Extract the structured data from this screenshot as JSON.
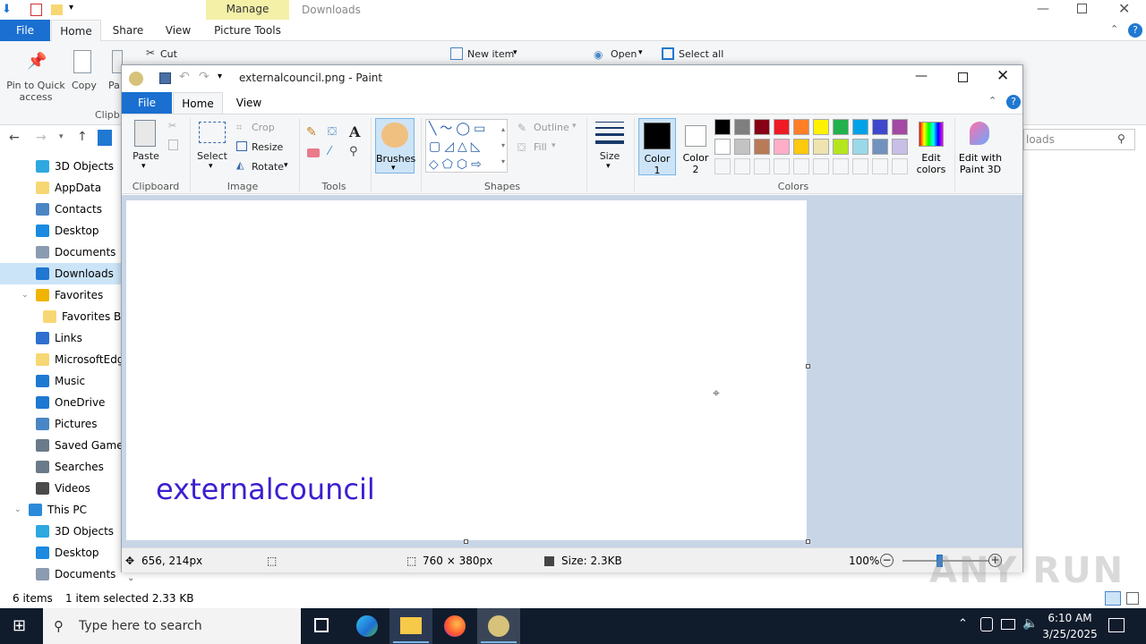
{
  "explorer": {
    "manage_tab": "Manage",
    "title": "Downloads",
    "tabs": {
      "file": "File",
      "home": "Home",
      "share": "Share",
      "view": "View",
      "picture_tools": "Picture Tools"
    },
    "ribbon": {
      "pin_line1": "Pin to Quick",
      "pin_line2": "access",
      "copy": "Copy",
      "paste_partial": "Pa",
      "cut": "Cut",
      "clipboard_partial": "Clipb",
      "new_item": "New item",
      "open": "Open",
      "select_all": "Select all"
    },
    "search_partial": "loads",
    "tree": [
      {
        "label": "3D Objects",
        "color": "#2ea8e0"
      },
      {
        "label": "AppData",
        "color": "#f7d774"
      },
      {
        "label": "Contacts",
        "color": "#4a86c5"
      },
      {
        "label": "Desktop",
        "color": "#1b8ae0"
      },
      {
        "label": "Documents",
        "color": "#8b9bb0"
      },
      {
        "label": "Downloads",
        "color": "#1f78d1"
      },
      {
        "label": "Favorites",
        "color": "#f0b400"
      },
      {
        "label": "Favorites Bar",
        "color": "#f7d774"
      },
      {
        "label": "Links",
        "color": "#2f6fd0"
      },
      {
        "label": "MicrosoftEdge",
        "color": "#f7d774"
      },
      {
        "label": "Music",
        "color": "#1f78d1"
      },
      {
        "label": "OneDrive",
        "color": "#1f78d1"
      },
      {
        "label": "Pictures",
        "color": "#4a86c5"
      },
      {
        "label": "Saved Games",
        "color": "#6a7a8a"
      },
      {
        "label": "Searches",
        "color": "#6a7a8a"
      },
      {
        "label": "Videos",
        "color": "#4a4a4a"
      },
      {
        "label": "This PC",
        "color": "#2a8ad8"
      },
      {
        "label": "3D Objects",
        "color": "#2ea8e0"
      },
      {
        "label": "Desktop",
        "color": "#1b8ae0"
      },
      {
        "label": "Documents",
        "color": "#8b9bb0"
      }
    ],
    "status": {
      "items": "6 items",
      "selected": "1 item selected  2.33 KB"
    }
  },
  "paint": {
    "title": "externalcouncil.png - Paint",
    "tabs": {
      "file": "File",
      "home": "Home",
      "view": "View"
    },
    "ribbon": {
      "paste": "Paste",
      "clipboard": "Clipboard",
      "select": "Select",
      "crop": "Crop",
      "resize": "Resize",
      "rotate": "Rotate",
      "image": "Image",
      "tools": "Tools",
      "brushes": "Brushes",
      "outline": "Outline",
      "fill": "Fill",
      "shapes": "Shapes",
      "size": "Size",
      "color1_line1": "Color",
      "color1_line2": "1",
      "color2_line1": "Color",
      "color2_line2": "2",
      "colors": "Colors",
      "edit_colors_line1": "Edit",
      "edit_colors_line2": "colors",
      "paint3d_line1": "Edit with",
      "paint3d_line2": "Paint 3D"
    },
    "palette_row1": [
      "#000000",
      "#7f7f7f",
      "#880015",
      "#ed1c24",
      "#ff7f27",
      "#fff200",
      "#22b14c",
      "#00a2e8",
      "#3f48cc",
      "#a349a4"
    ],
    "palette_row2": [
      "#ffffff",
      "#c3c3c3",
      "#b97a57",
      "#ffaec9",
      "#ffc90e",
      "#efe4b0",
      "#b5e61d",
      "#99d9ea",
      "#7092be",
      "#c8bfe7"
    ],
    "canvas_text": "externalcouncil",
    "status": {
      "cursor": "656, 214px",
      "dimensions": "760 × 380px",
      "size": "Size: 2.3KB",
      "zoom": "100%"
    }
  },
  "taskbar": {
    "search_placeholder": "Type here to search",
    "time": "6:10 AM",
    "date": "3/25/2025"
  },
  "watermark": "ANY RUN"
}
